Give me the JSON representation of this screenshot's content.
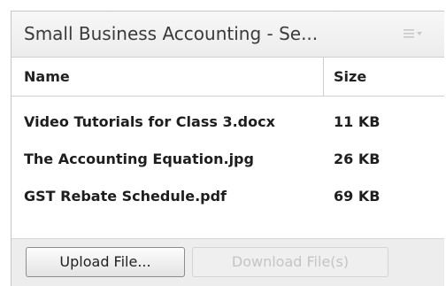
{
  "panel": {
    "title": "Small Business Accounting - Se...",
    "menu_icon": "list-menu-icon"
  },
  "table": {
    "columns": [
      "Name",
      "Size"
    ],
    "rows": [
      {
        "name": "Video Tutorials for Class 3.docx",
        "size": "11 KB"
      },
      {
        "name": "The Accounting Equation.jpg",
        "size": "26 KB"
      },
      {
        "name": "GST Rebate Schedule.pdf",
        "size": "69 KB"
      }
    ]
  },
  "footer": {
    "upload_label": "Upload File...",
    "download_label": "Download File(s)",
    "download_enabled": false
  }
}
